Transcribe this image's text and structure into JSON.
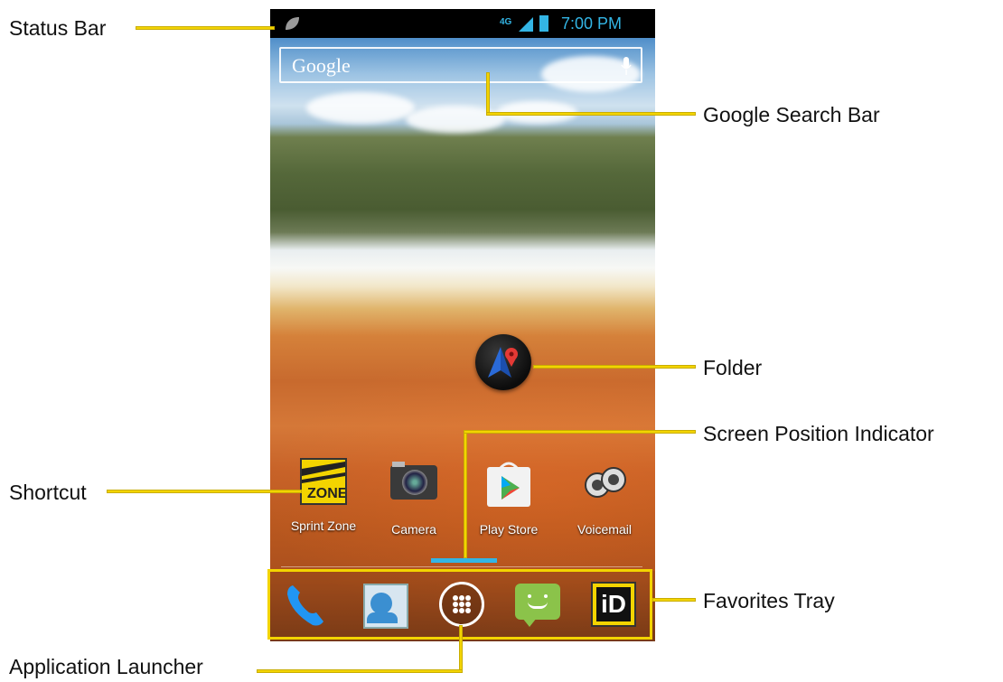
{
  "callouts": {
    "status_bar": "Status Bar",
    "google_search_bar": "Google Search Bar",
    "folder": "Folder",
    "screen_position_indicator": "Screen Position Indicator",
    "shortcut": "Shortcut",
    "favorites_tray": "Favorites Tray",
    "application_launcher": "Application Launcher"
  },
  "status_bar": {
    "network": "4G",
    "time": "7:00 PM"
  },
  "search": {
    "label": "Google"
  },
  "home_apps": [
    {
      "label": "Sprint Zone",
      "icon": "sprint-zone-icon"
    },
    {
      "label": "Camera",
      "icon": "camera-icon"
    },
    {
      "label": "Play Store",
      "icon": "play-store-icon"
    },
    {
      "label": "Voicemail",
      "icon": "voicemail-icon"
    }
  ],
  "tray": [
    {
      "icon": "phone-icon"
    },
    {
      "icon": "contacts-icon"
    },
    {
      "icon": "app-launcher-icon"
    },
    {
      "icon": "messaging-icon"
    },
    {
      "icon": "id-icon"
    }
  ],
  "colors": {
    "callout_line": "#f3d400",
    "status_accent": "#33b5e5"
  }
}
